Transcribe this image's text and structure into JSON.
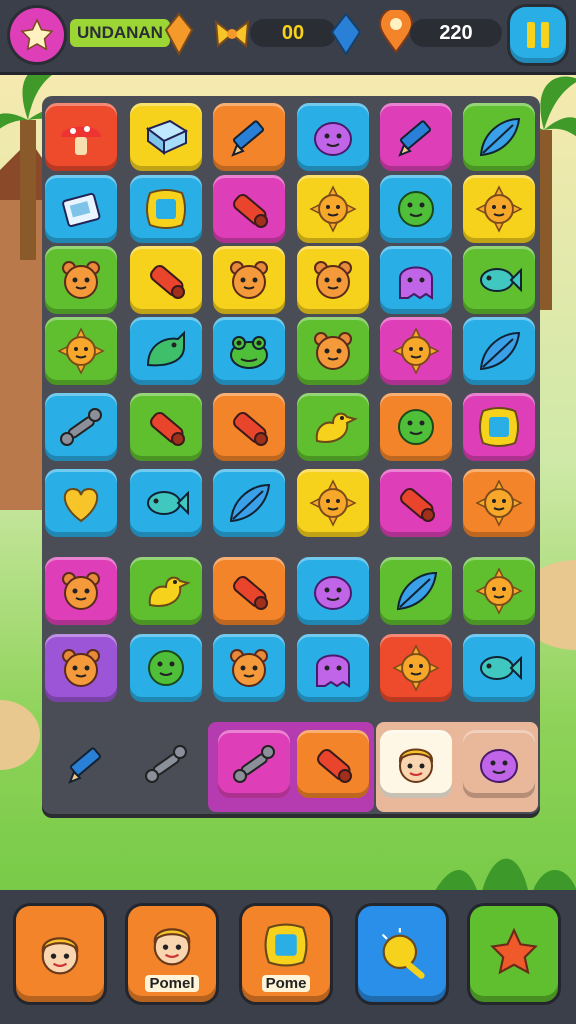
{
  "topbar": {
    "level_name": "UNDANAN",
    "coins": "00",
    "score": "220"
  },
  "icons": {
    "star": "star-icon",
    "pause": "pause-icon",
    "gem": "gem-icon",
    "bow": "bow-icon",
    "pin": "pin-icon"
  },
  "colors": {
    "red": "#ee4a2c",
    "yellow": "#f7d21c",
    "orange": "#f4842a",
    "blue": "#29aee6",
    "pink": "#de3fb8",
    "green": "#5fbf2f",
    "purple": "#9b55d6"
  },
  "grid": [
    [
      {
        "c": "red",
        "i": "mushroom"
      },
      {
        "c": "yellow",
        "i": "book"
      },
      {
        "c": "orange",
        "i": "pencil"
      },
      {
        "c": "blue",
        "i": "blob"
      },
      {
        "c": "pink",
        "i": "pencil"
      },
      {
        "c": "green",
        "i": "leaf"
      }
    ],
    [
      {
        "c": "blue",
        "i": "box"
      },
      {
        "c": "blue",
        "i": "frame"
      },
      {
        "c": "pink",
        "i": "crayon"
      },
      {
        "c": "yellow",
        "i": "sun"
      },
      {
        "c": "blue",
        "i": "ball"
      },
      {
        "c": "yellow",
        "i": "sun"
      }
    ],
    [
      {
        "c": "green",
        "i": "bear"
      },
      {
        "c": "yellow",
        "i": "crayon"
      },
      {
        "c": "yellow",
        "i": "bear"
      },
      {
        "c": "yellow",
        "i": "bear"
      },
      {
        "c": "blue",
        "i": "ghost"
      },
      {
        "c": "green",
        "i": "fish"
      }
    ],
    [
      {
        "c": "green",
        "i": "sun"
      },
      {
        "c": "blue",
        "i": "dino"
      },
      {
        "c": "blue",
        "i": "frog"
      },
      {
        "c": "green",
        "i": "bear"
      },
      {
        "c": "pink",
        "i": "sun"
      },
      {
        "c": "blue",
        "i": "leaf"
      }
    ],
    [
      {
        "c": "blue",
        "i": "bone"
      },
      {
        "c": "green",
        "i": "crayon"
      },
      {
        "c": "orange",
        "i": "crayon"
      },
      {
        "c": "green",
        "i": "duck"
      },
      {
        "c": "orange",
        "i": "ball"
      },
      {
        "c": "pink",
        "i": "frame"
      }
    ],
    [
      {
        "c": "blue",
        "i": "heart"
      },
      {
        "c": "blue",
        "i": "fish"
      },
      {
        "c": "blue",
        "i": "leaf"
      },
      {
        "c": "yellow",
        "i": "sun"
      },
      {
        "c": "pink",
        "i": "crayon"
      },
      {
        "c": "orange",
        "i": "sun"
      }
    ],
    [
      {
        "c": "pink",
        "i": "bear"
      },
      {
        "c": "green",
        "i": "duck"
      },
      {
        "c": "orange",
        "i": "crayon"
      },
      {
        "c": "blue",
        "i": "blob"
      },
      {
        "c": "green",
        "i": "leaf"
      },
      {
        "c": "green",
        "i": "sun"
      }
    ],
    [
      {
        "c": "purple",
        "i": "bear"
      },
      {
        "c": "blue",
        "i": "ball"
      },
      {
        "c": "blue",
        "i": "bear"
      },
      {
        "c": "blue",
        "i": "ghost"
      },
      {
        "c": "red",
        "i": "sun"
      },
      {
        "c": "blue",
        "i": "fish"
      }
    ]
  ],
  "tray": [
    {
      "c": "none",
      "i": "pencil"
    },
    {
      "c": "none",
      "i": "bone"
    },
    {
      "c": "pink",
      "i": "bone"
    },
    {
      "c": "orange",
      "i": "crayon"
    },
    {
      "c": "white",
      "i": "face"
    },
    {
      "c": "peach",
      "i": "blob"
    }
  ],
  "bottom_buttons": [
    {
      "label": "",
      "icon": "face",
      "color": "orange",
      "name": "boost-character-button"
    },
    {
      "label": "Pomel",
      "icon": "face",
      "color": "orange",
      "name": "boost-pomel-button"
    },
    {
      "label": "Pome",
      "icon": "frame",
      "color": "orange",
      "name": "boost-pome-button"
    },
    {
      "label": "",
      "icon": "bulb",
      "color": "blue",
      "name": "hint-button"
    },
    {
      "label": "",
      "icon": "star",
      "color": "green",
      "name": "star-boost-button"
    }
  ]
}
